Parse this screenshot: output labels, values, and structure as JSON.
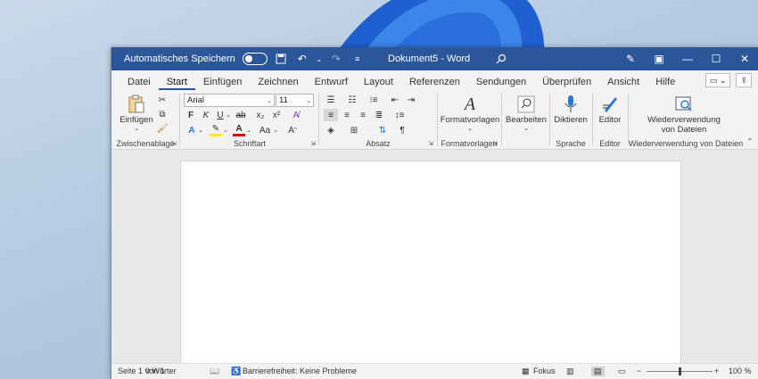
{
  "titlebar": {
    "autosave_label": "Automatisches Speichern",
    "title": "Dokument5  -  Word"
  },
  "tabs": [
    "Datei",
    "Start",
    "Einfügen",
    "Zeichnen",
    "Entwurf",
    "Layout",
    "Referenzen",
    "Sendungen",
    "Überprüfen",
    "Ansicht",
    "Hilfe"
  ],
  "ribbon": {
    "clipboard": {
      "paste": "Einfügen",
      "label": "Zwischenablage"
    },
    "font": {
      "name": "Arial",
      "size": "11",
      "bold": "F",
      "italic": "K",
      "underline": "U",
      "strike": "ab",
      "sub": "x₂",
      "sup": "x²",
      "case": "Aa",
      "label": "Schriftart"
    },
    "paragraph": {
      "label": "Absatz"
    },
    "styles": {
      "button": "Formatvorlagen",
      "label": "Formatvorlagen"
    },
    "editing": {
      "button": "Bearbeiten"
    },
    "voice": {
      "button": "Diktieren",
      "label": "Sprache"
    },
    "editor": {
      "button": "Editor",
      "label": "Editor"
    },
    "reuse": {
      "button_line1": "Wiederverwendung",
      "button_line2": "von Dateien",
      "label": "Wiederverwendung von Dateien"
    }
  },
  "status": {
    "page": "Seite 1 von 1",
    "words": "0 Wörter",
    "accessibility": "Barrierefreiheit: Keine Probleme",
    "focus": "Fokus",
    "zoom": "100 %",
    "minus": "−",
    "plus": "+"
  },
  "colors": {
    "titlebar": "#2b579a",
    "accent": "#2b579a"
  }
}
